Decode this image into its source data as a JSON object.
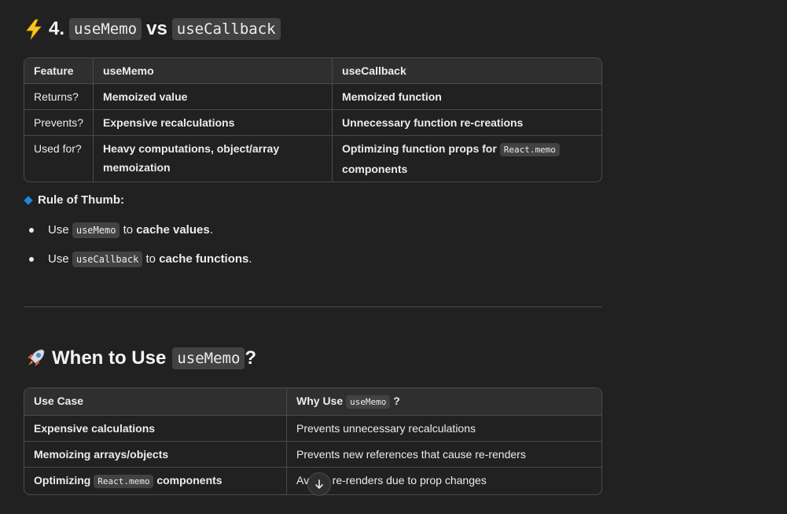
{
  "section1": {
    "heading_prefix": "4.",
    "heading_code_a": "useMemo",
    "heading_mid": "vs",
    "heading_code_b": "useCallback",
    "table": {
      "headers": [
        "Feature",
        "useMemo",
        "useCallback"
      ],
      "rows": [
        {
          "feature": "Returns?",
          "memo": "Memoized value",
          "callback": "Memoized function"
        },
        {
          "feature": "Prevents?",
          "memo": "Expensive recalculations",
          "callback": "Unnecessary function re-creations"
        },
        {
          "feature": "Used for?",
          "memo_line1": "Heavy computations, object/array",
          "memo_line2": "memoization",
          "callback_prefix": "Optimizing function props for",
          "callback_code": "React.memo",
          "callback_line2": "components"
        }
      ]
    }
  },
  "rule": {
    "label": "Rule of Thumb:",
    "items": [
      {
        "pre": "Use",
        "code": "useMemo",
        "mid": "to",
        "bold": "cache values",
        "post": "."
      },
      {
        "pre": "Use",
        "code": "useCallback",
        "mid": "to",
        "bold": "cache functions",
        "post": "."
      }
    ]
  },
  "section2": {
    "heading_text": "When to Use",
    "heading_code": "useMemo",
    "heading_suffix": "?",
    "table": {
      "header_a": "Use Case",
      "header_b_pre": "Why Use",
      "header_b_code": "useMemo",
      "header_b_post": "?",
      "rows": [
        {
          "case": "Expensive calculations",
          "why": "Prevents unnecessary recalculations"
        },
        {
          "case": "Memoizing arrays/objects",
          "why": "Prevents new references that cause re-renders"
        },
        {
          "case_pre": "Optimizing",
          "case_code": "React.memo",
          "case_post": "components",
          "why": "Avoids re-renders due to prop changes"
        }
      ]
    }
  },
  "colors": {
    "background": "#212121",
    "accent_diamond": "#1e88e5",
    "code_bg": "#424242"
  },
  "icons": [
    "lightning-icon",
    "rocket-icon",
    "diamond-icon",
    "arrow-down-icon"
  ]
}
